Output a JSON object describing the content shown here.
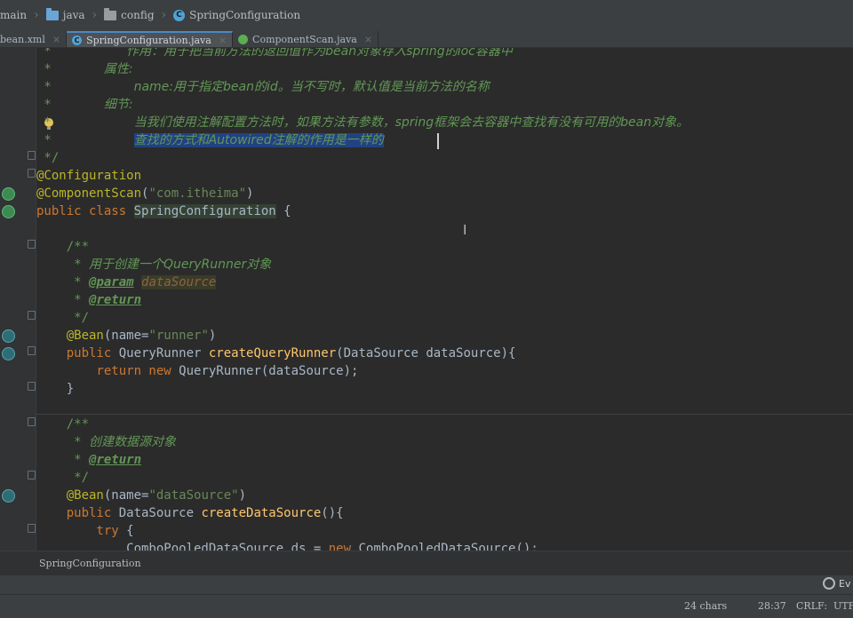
{
  "breadcrumb": {
    "items": [
      {
        "label": "main",
        "icon": "none"
      },
      {
        "label": "java",
        "icon": "folder-icon"
      },
      {
        "label": "config",
        "icon": "folder-icon"
      },
      {
        "label": "SpringConfiguration",
        "icon": "class-icon"
      }
    ]
  },
  "tabs": [
    {
      "label": "bean.xml",
      "close": "×"
    },
    {
      "label": "SpringConfiguration.java",
      "close": "×",
      "active": true
    },
    {
      "label": "ComponentScan.java",
      "close": "×"
    }
  ],
  "code": {
    "l01": {
      "a": " *          ",
      "b": "作用：用于把当前方法的返回值作为bean对象存入spring的ioc容器中"
    },
    "l02": {
      "a": " *       ",
      "b": "属性:"
    },
    "l03": {
      "a": " *           ",
      "b": "name:用于指定bean的id。当不写时，默认值是当前方法的名称"
    },
    "l04": {
      "a": " *       ",
      "b": "细节:"
    },
    "l05": {
      "a": " *           ",
      "b": "当我们使用注解配置方法时，如果方法有参数，spring框架会去容器中查找有没有可用的bean对象。"
    },
    "l06": {
      "a": " *           ",
      "b": "查找的方式和Autowired注解的作用是一样的"
    },
    "l07": " */",
    "l08": "@Configuration",
    "l09": {
      "an": "@ComponentScan",
      "p1": "(",
      "str": "\"com.itheima\"",
      "p2": ")"
    },
    "l10": {
      "kw": "public class ",
      "cls": "SpringConfiguration",
      "rest": " {"
    },
    "l12": "    /**",
    "l13": {
      "a": "     * ",
      "b": "用于创建一个QueryRunner对象"
    },
    "l14": {
      "a": "     * ",
      "tag": "@param",
      "sp": " ",
      "name": "dataSource"
    },
    "l15": {
      "a": "     * ",
      "tag": "@return"
    },
    "l16": "     */",
    "l17": {
      "an": "    @Bean",
      "p1": "(name=",
      "str": "\"runner\"",
      "p2": ")"
    },
    "l18": {
      "kw": "    public ",
      "t": "QueryRunner ",
      "fn": "createQueryRunner",
      "rest": "(DataSource dataSource){"
    },
    "l19": {
      "kw": "        return new ",
      "rest": "QueryRunner(dataSource);"
    },
    "l20": "    }",
    "l22": "    /**",
    "l23": {
      "a": "     * ",
      "b": "创建数据源对象"
    },
    "l24": {
      "a": "     * ",
      "tag": "@return"
    },
    "l25": "     */",
    "l26": {
      "an": "    @Bean",
      "p1": "(name=",
      "str": "\"dataSource\"",
      "p2": ")"
    },
    "l27": {
      "kw": "    public ",
      "t": "DataSource ",
      "fn": "createDataSource",
      "rest": "(){"
    },
    "l28": {
      "kw": "        try",
      "rest": " {"
    },
    "l29": {
      "a": "            ComboPooledDataSource ds = ",
      "kw": "new",
      "b": " ComboPooledDataSource();"
    }
  },
  "bottom_breadcrumb": "SpringConfiguration",
  "search_label": "Ev",
  "status": {
    "chars": "24 chars",
    "position": "28:37",
    "line_sep": "CRLF:",
    "encoding": "UTF-"
  },
  "colors": {
    "background": "#2b2b2b",
    "keyword": "#cc7832",
    "annotation": "#bbb529",
    "string": "#6a8759",
    "comment": "#629755",
    "method": "#ffc66d",
    "selection": "#214283"
  }
}
